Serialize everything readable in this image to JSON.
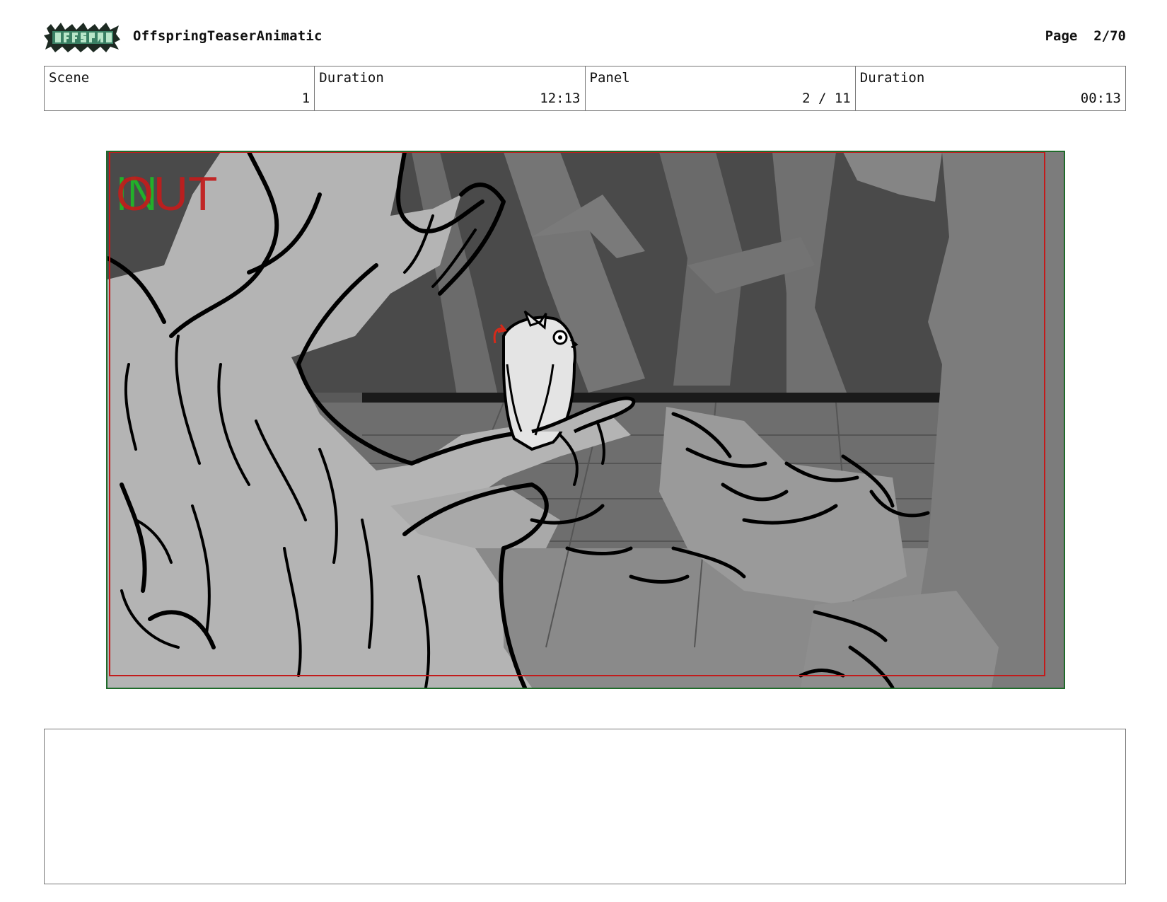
{
  "header": {
    "logo_text": "OFFSPRING",
    "project_title": "OffspringTeaserAnimatic",
    "page_label": "Page",
    "page_value": "2/70"
  },
  "info": {
    "scene_label": "Scene",
    "scene_value": "1",
    "scene_duration_label": "Duration",
    "scene_duration_value": "12:13",
    "panel_label": "Panel",
    "panel_value": "2 / 11",
    "panel_duration_label": "Duration",
    "panel_duration_value": "00:13"
  },
  "panel": {
    "marker_in": "IN",
    "marker_out": "OUT",
    "colors": {
      "safe_frame": "#c21b1b",
      "camera_frame": "#1f6b2a",
      "in_marker": "#22b02a"
    }
  },
  "notes": {
    "text": ""
  }
}
